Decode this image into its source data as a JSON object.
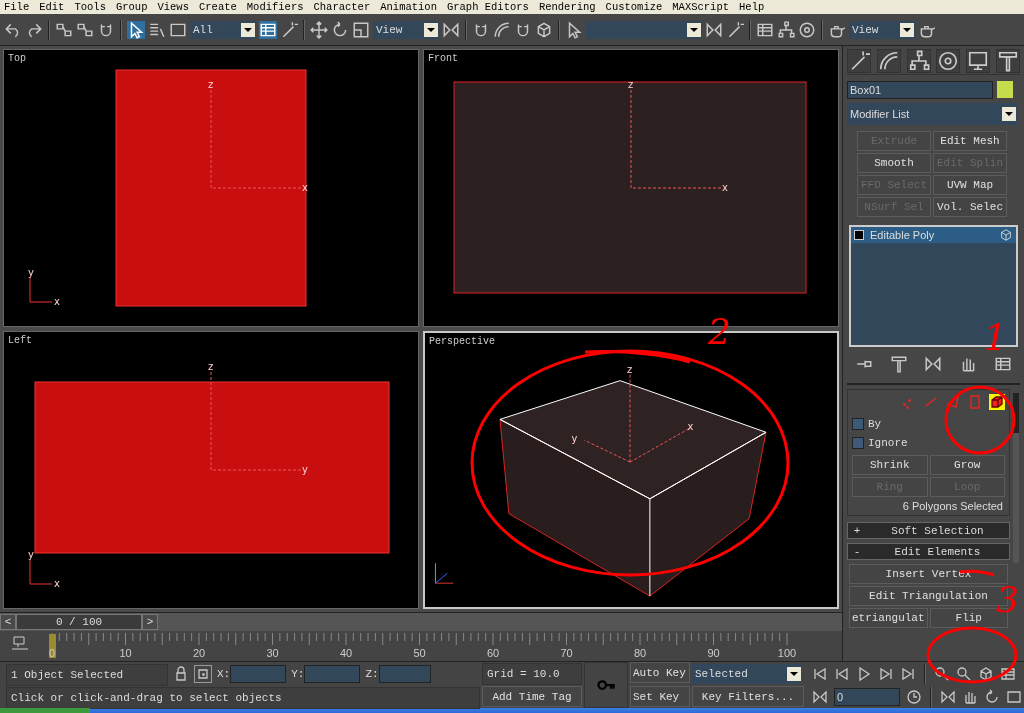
{
  "menu": [
    "File",
    "Edit",
    "Tools",
    "Group",
    "Views",
    "Create",
    "Modifiers",
    "Character",
    "Animation",
    "Graph Editors",
    "Rendering",
    "Customize",
    "MAXScript",
    "Help"
  ],
  "toolbar": {
    "selection_filter": "All",
    "reference_coordinate": "View",
    "render_view": "View"
  },
  "viewports": [
    {
      "label": "Top",
      "kind": "filled",
      "active": false,
      "gizmo": [
        "z",
        "x"
      ],
      "tripod": [
        "y",
        "x"
      ]
    },
    {
      "label": "Front",
      "kind": "outline",
      "active": false,
      "gizmo": [
        "z",
        "x"
      ]
    },
    {
      "label": "Left",
      "kind": "wide",
      "active": false,
      "gizmo": [
        "z",
        "y"
      ],
      "tripod": [
        "y",
        "x"
      ]
    },
    {
      "label": "Perspective",
      "kind": "box",
      "active": true,
      "gizmo": [
        "z",
        "x",
        "y"
      ]
    }
  ],
  "command_panel": {
    "object_name": "Box01",
    "modifier_list": "Modifier List",
    "modifier_buttons": [
      {
        "label": "Extrude",
        "disabled": true
      },
      {
        "label": "Edit Mesh",
        "disabled": false
      },
      {
        "label": "Smooth",
        "disabled": false
      },
      {
        "label": "Edit Splin",
        "disabled": true
      },
      {
        "label": "FFD Select",
        "disabled": true
      },
      {
        "label": "UVW Map",
        "disabled": false
      },
      {
        "label": "NSurf Sel",
        "disabled": true
      },
      {
        "label": "Vol. Selec",
        "disabled": false
      }
    ],
    "stack": [
      {
        "label": "Editable Poly",
        "selected": true
      }
    ],
    "selection": {
      "levels": [
        {
          "kind": "vertex",
          "selected": false
        },
        {
          "kind": "edge",
          "selected": false
        },
        {
          "kind": "border",
          "selected": false
        },
        {
          "kind": "polygon",
          "selected": false
        },
        {
          "kind": "element",
          "selected": true
        }
      ],
      "options": [
        {
          "label": "By",
          "checked": false
        },
        {
          "label": "Ignore",
          "checked": false
        }
      ],
      "buttons": [
        {
          "label": "Shrink",
          "disabled": false
        },
        {
          "label": "Grow",
          "disabled": false
        },
        {
          "label": "Ring",
          "disabled": true
        },
        {
          "label": "Loop",
          "disabled": true
        }
      ],
      "status": "6 Polygons Selected"
    },
    "rollouts": [
      {
        "sign": "+",
        "title": "Soft Selection"
      },
      {
        "sign": "-",
        "title": "Edit Elements"
      }
    ],
    "edit_elements": [
      {
        "label": "Insert Vertex",
        "kind": "full"
      },
      {
        "label": "Edit Triangulation",
        "kind": "full"
      },
      {
        "label": "etriangulat",
        "kind": "half"
      },
      {
        "label": "Flip",
        "kind": "half"
      }
    ]
  },
  "time_slider": {
    "prev": "<",
    "position": "0 / 100",
    "next": ">",
    "level": 0
  },
  "track_bar": {
    "ticks": [
      "0",
      "10",
      "20",
      "30",
      "40",
      "50",
      "60",
      "70",
      "80",
      "90",
      "100"
    ]
  },
  "status": {
    "selection": "1 Object Selected",
    "x_label": "X:",
    "y_label": "Y:",
    "z_label": "Z:",
    "grid": "Grid = 10.0",
    "prompt": "Click or click-and-drag to select objects",
    "add_time_tag": "Add Time Tag"
  },
  "animation": {
    "auto_key": "Auto Key",
    "key_mode": "Selected",
    "set_key": "Set Key",
    "key_filters": "Key Filters...",
    "frame": "0"
  },
  "annotations": [
    {
      "label": "2"
    },
    {
      "label": "1"
    },
    {
      "label": "3"
    }
  ]
}
